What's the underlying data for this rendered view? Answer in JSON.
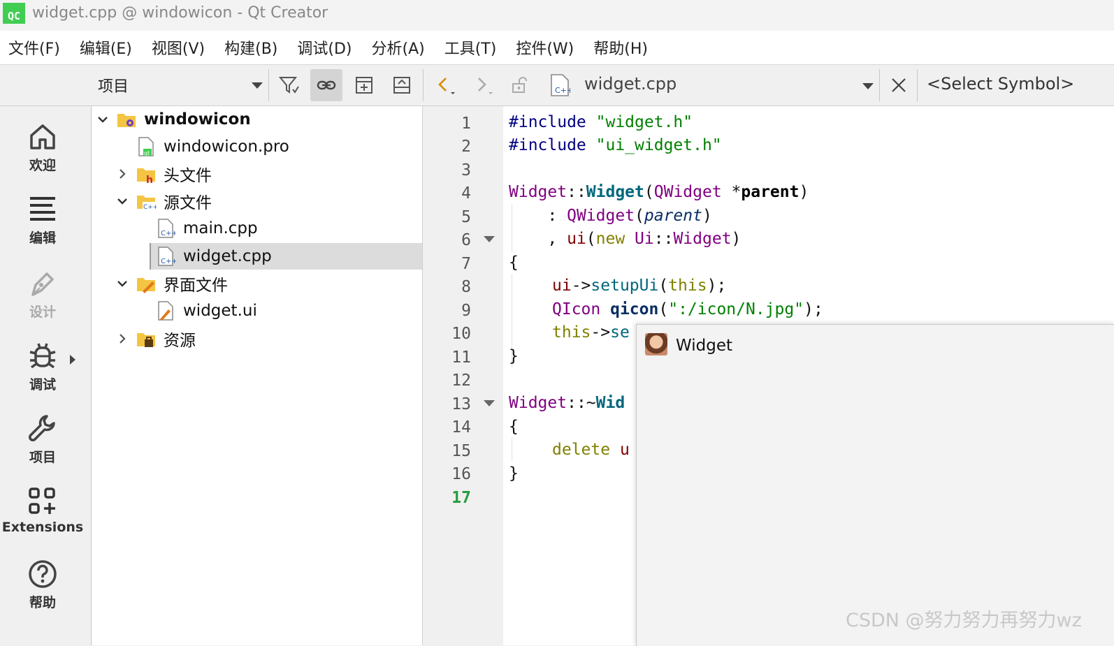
{
  "window": {
    "app_badge": "QC",
    "title": "widget.cpp @ windowicon - Qt Creator"
  },
  "menu": [
    "文件(F)",
    "编辑(E)",
    "视图(V)",
    "构建(B)",
    "调试(D)",
    "分析(A)",
    "工具(T)",
    "控件(W)",
    "帮助(H)"
  ],
  "toolbar": {
    "project_view": "项目",
    "file_name": "widget.cpp",
    "symbol": "<Select Symbol>"
  },
  "modes": [
    {
      "label": "欢迎",
      "icon": "home-icon",
      "enabled": true
    },
    {
      "label": "编辑",
      "icon": "edit-lines-icon",
      "enabled": true
    },
    {
      "label": "设计",
      "icon": "design-pen-icon",
      "enabled": false
    },
    {
      "label": "调试",
      "icon": "bug-icon",
      "enabled": true
    },
    {
      "label": "项目",
      "icon": "wrench-icon",
      "enabled": true
    },
    {
      "label": "Extensions",
      "icon": "extensions-icon",
      "enabled": true
    },
    {
      "label": "帮助",
      "icon": "help-icon",
      "enabled": true
    }
  ],
  "tree": [
    {
      "label": "windowicon",
      "expanded": true,
      "icon": "project-folder-icon"
    },
    {
      "label": "windowicon.pro",
      "icon": "qt-pro-file-icon"
    },
    {
      "label": "头文件",
      "expanded": false,
      "icon": "headers-folder-icon"
    },
    {
      "label": "源文件",
      "expanded": true,
      "icon": "sources-folder-icon"
    },
    {
      "label": "main.cpp",
      "icon": "cpp-file-icon"
    },
    {
      "label": "widget.cpp",
      "icon": "cpp-file-icon",
      "selected": true
    },
    {
      "label": "界面文件",
      "expanded": true,
      "icon": "forms-folder-icon"
    },
    {
      "label": "widget.ui",
      "icon": "ui-file-icon"
    },
    {
      "label": "资源",
      "expanded": false,
      "icon": "resources-folder-icon"
    }
  ],
  "editor": {
    "line_numbers": [
      "1",
      "2",
      "3",
      "4",
      "5",
      "6",
      "7",
      "8",
      "9",
      "10",
      "11",
      "12",
      "13",
      "14",
      "15",
      "16",
      "17"
    ],
    "current_line": 17,
    "code": {
      "l1_dir": "#include",
      "l1_str": "\"widget.h\"",
      "l2_dir": "#include",
      "l2_str": "\"ui_widget.h\"",
      "l4_cls": "Widget",
      "l4_sep": "::",
      "l4_fn": "Widget",
      "l4_open": "(",
      "l4_type": "QWidget",
      "l4_star": " *",
      "l4_param": "parent",
      "l4_close": ")",
      "l5_colon": "    : ",
      "l5_base": "QWidget",
      "l5_open": "(",
      "l5_arg": "parent",
      "l5_close": ")",
      "l6_comma": "    , ",
      "l6_mem": "ui",
      "l6_open": "(",
      "l6_new": "new",
      "l6_ns": " Ui",
      "l6_sep": "::",
      "l6_cls": "Widget",
      "l6_close": ")",
      "l7": "{",
      "l8_mem": "ui",
      "l8_arrow": "->",
      "l8_fn": "setupUi",
      "l8_open": "(",
      "l8_this": "this",
      "l8_close": ");",
      "l9_type": "QIcon",
      "l9_var": "qicon",
      "l9_open": "(",
      "l9_str": "\":/icon/N.jpg\"",
      "l9_close": ");",
      "l10_this": "this",
      "l10_arrow": "->",
      "l10_rest": "se",
      "l11": "}",
      "l13_cls": "Widget",
      "l13_sep": "::~",
      "l13_fn": "Wid",
      "l14": "{",
      "l15_kw": "delete",
      "l15_rest": " u",
      "l16": "}"
    }
  },
  "popup": {
    "title": "Widget"
  },
  "watermark": "CSDN @努力努力再努力wz"
}
